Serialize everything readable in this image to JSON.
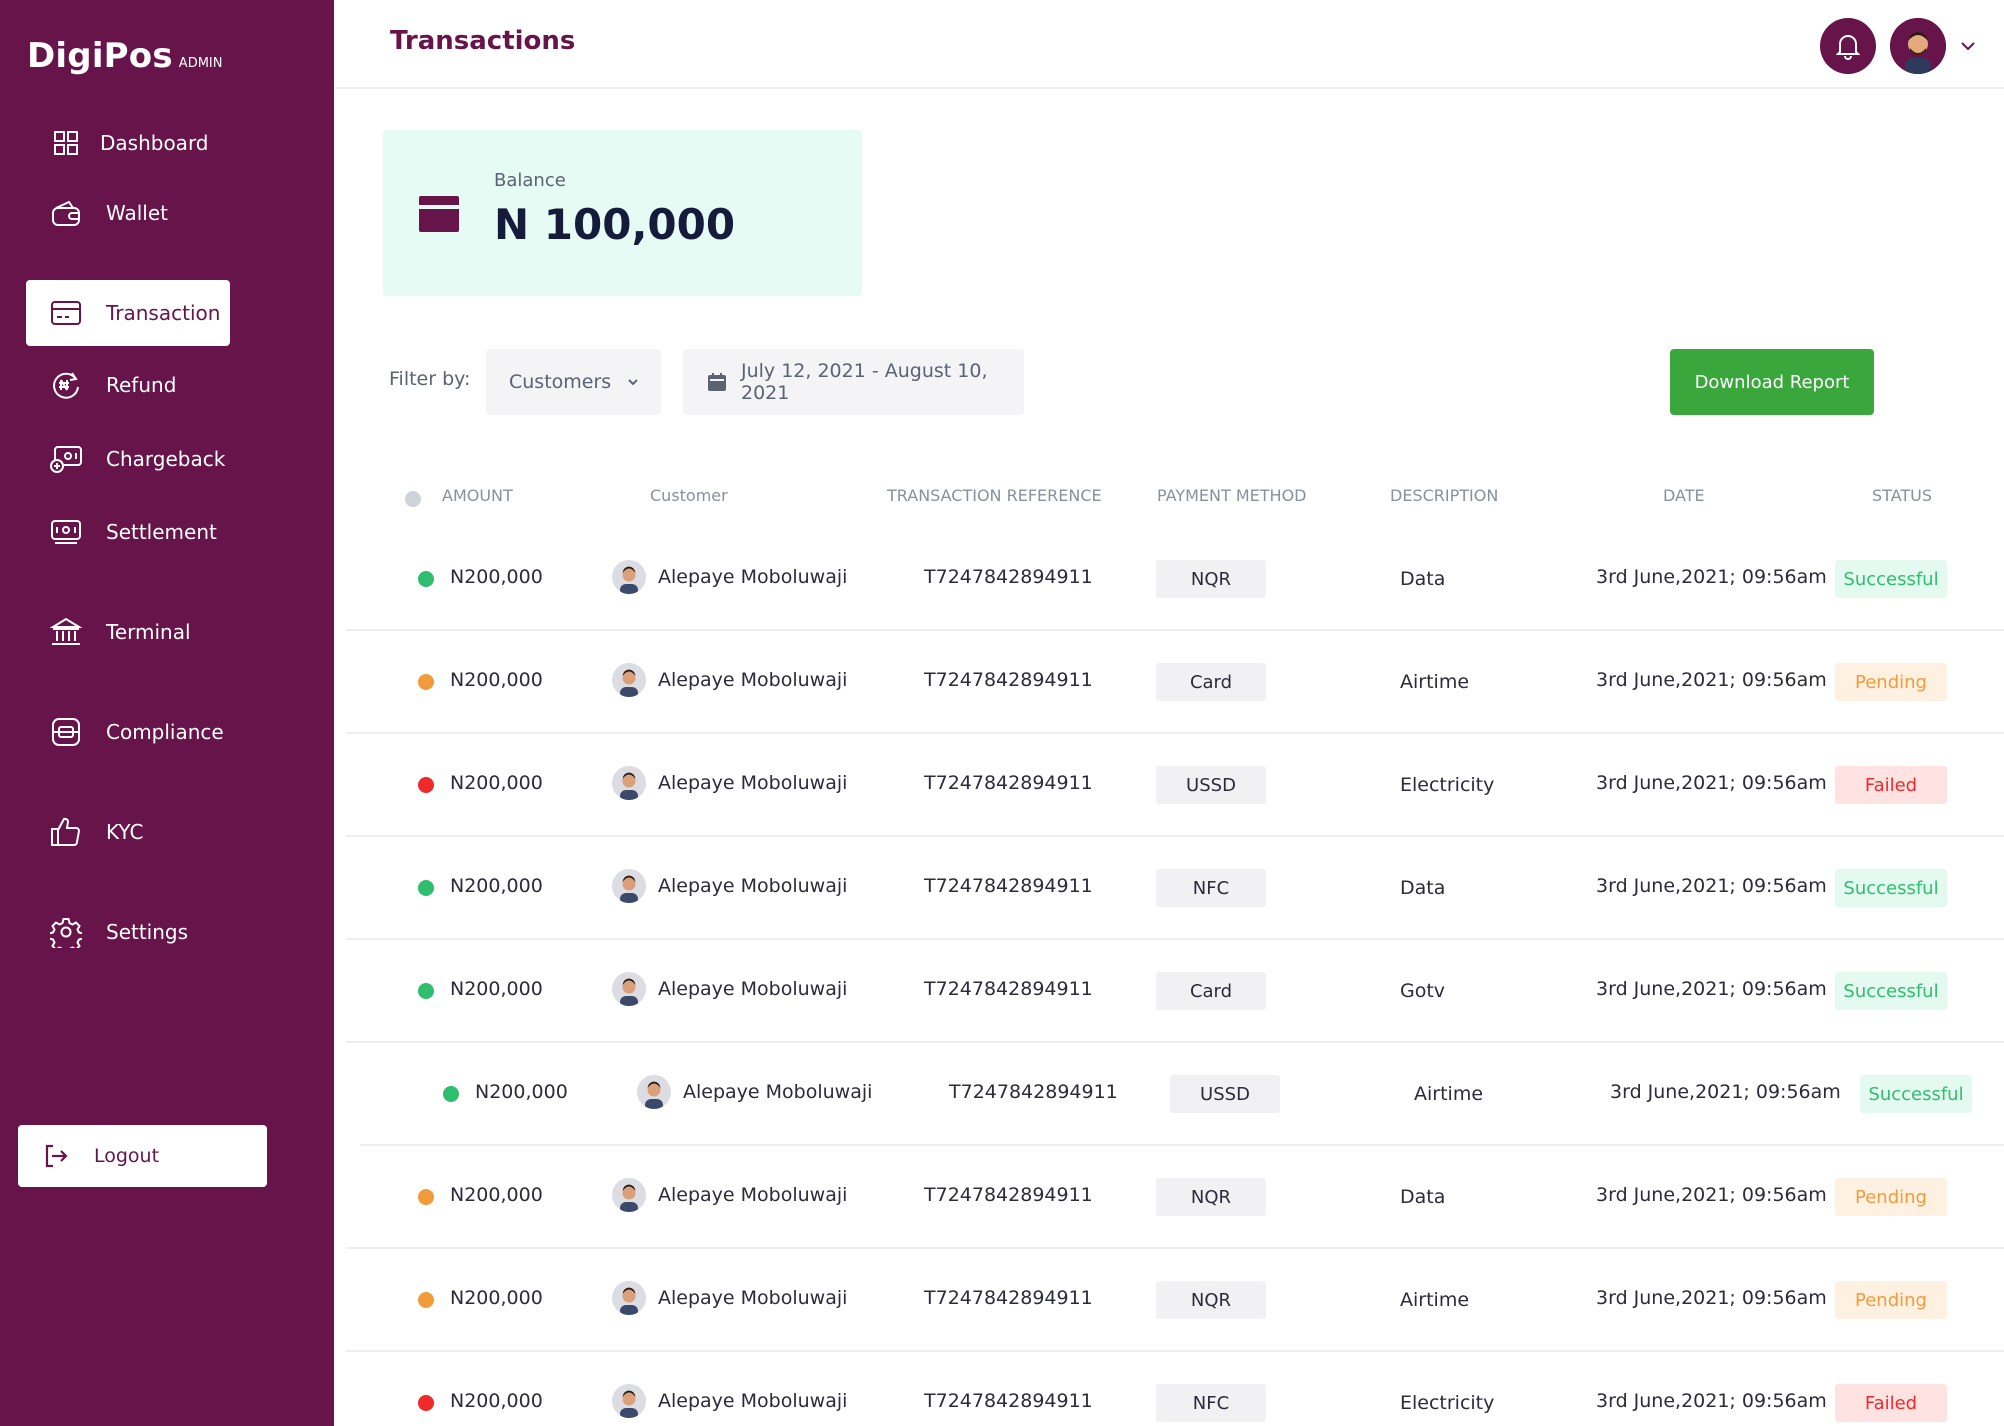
{
  "brand": {
    "name": "DigiPos",
    "tag": "ADMIN"
  },
  "sidebar": {
    "items": [
      {
        "label": "Dashboard",
        "icon": "dashboard-grid-icon"
      },
      {
        "label": "Wallet",
        "icon": "wallet-icon"
      },
      {
        "label": "Transaction",
        "icon": "card-icon",
        "active": true
      },
      {
        "label": "Refund",
        "icon": "refund-icon"
      },
      {
        "label": "Chargeback",
        "icon": "chargeback-icon"
      },
      {
        "label": "Settlement",
        "icon": "settlement-icon"
      },
      {
        "label": "Terminal",
        "icon": "bank-icon"
      },
      {
        "label": "Compliance",
        "icon": "compliance-icon"
      },
      {
        "label": "KYC",
        "icon": "thumbs-up-icon"
      },
      {
        "label": "Settings",
        "icon": "gear-icon"
      }
    ],
    "logout_label": "Logout"
  },
  "header": {
    "title": "Transactions"
  },
  "balance": {
    "label": "Balance",
    "value": "N 100,000"
  },
  "filters": {
    "label": "Filter by:",
    "customer_select": "Customers",
    "date_range": "July 12, 2021 - August 10, 2021",
    "download_label": "Download Report"
  },
  "table": {
    "headers": {
      "amount": "AMOUNT",
      "customer": "Customer",
      "reference": "TRANSACTION REFERENCE",
      "method": "PAYMENT METHOD",
      "description": "DESCRIPTION",
      "date": "DATE",
      "status": "STATUS"
    },
    "rows": [
      {
        "amount": "N200,000",
        "customer": "Alepaye Moboluwaji",
        "reference": "T7247842894911",
        "method": "NQR",
        "description": "Data",
        "date": "3rd June,2021; 09:56am",
        "status": "Successful"
      },
      {
        "amount": "N200,000",
        "customer": "Alepaye Moboluwaji",
        "reference": "T7247842894911",
        "method": "Card",
        "description": "Airtime",
        "date": "3rd June,2021; 09:56am",
        "status": "Pending"
      },
      {
        "amount": "N200,000",
        "customer": "Alepaye Moboluwaji",
        "reference": "T7247842894911",
        "method": "USSD",
        "description": "Electricity",
        "date": "3rd June,2021; 09:56am",
        "status": "Failed"
      },
      {
        "amount": "N200,000",
        "customer": "Alepaye Moboluwaji",
        "reference": "T7247842894911",
        "method": "NFC",
        "description": "Data",
        "date": "3rd June,2021; 09:56am",
        "status": "Successful"
      },
      {
        "amount": "N200,000",
        "customer": "Alepaye Moboluwaji",
        "reference": "T7247842894911",
        "method": "Card",
        "description": "Gotv",
        "date": "3rd June,2021; 09:56am",
        "status": "Successful"
      },
      {
        "amount": "N200,000",
        "customer": "Alepaye Moboluwaji",
        "reference": "T7247842894911",
        "method": "USSD",
        "description": "Airtime",
        "date": "3rd June,2021; 09:56am",
        "status": "Successful"
      },
      {
        "amount": "N200,000",
        "customer": "Alepaye Moboluwaji",
        "reference": "T7247842894911",
        "method": "NQR",
        "description": "Data",
        "date": "3rd June,2021; 09:56am",
        "status": "Pending"
      },
      {
        "amount": "N200,000",
        "customer": "Alepaye Moboluwaji",
        "reference": "T7247842894911",
        "method": "NQR",
        "description": "Airtime",
        "date": "3rd June,2021; 09:56am",
        "status": "Pending"
      },
      {
        "amount": "N200,000",
        "customer": "Alepaye Moboluwaji",
        "reference": "T7247842894911",
        "method": "NFC",
        "description": "Electricity",
        "date": "3rd June,2021; 09:56am",
        "status": "Failed"
      }
    ]
  },
  "colors": {
    "brand": "#66144a",
    "success": "#2fbd6e",
    "pending": "#f29b3a",
    "failed": "#ee2a2a",
    "download": "#3aa73d",
    "balance_bg": "#e6fbf3"
  }
}
